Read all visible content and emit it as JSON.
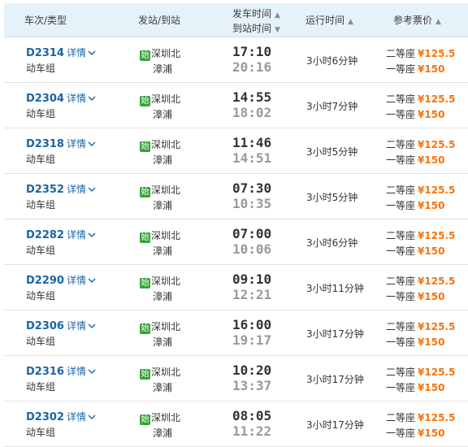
{
  "header": {
    "train_type": "车次/类型",
    "station": "发站/到站",
    "depart_time": "发车时间",
    "arrive_time": "到站时间",
    "duration": "运行时间",
    "price": "参考票价"
  },
  "labels": {
    "detail": "详情",
    "start_badge": "始",
    "second_class": "二等座",
    "first_class": "一等座"
  },
  "rows": [
    {
      "train": "D2314",
      "type": "动车组",
      "from": "深圳北",
      "to": "漳浦",
      "dep": "17:10",
      "arr": "20:16",
      "duration": "3小时6分钟",
      "p2": "¥125.5",
      "p1": "¥150"
    },
    {
      "train": "D2304",
      "type": "动车组",
      "from": "深圳北",
      "to": "漳浦",
      "dep": "14:55",
      "arr": "18:02",
      "duration": "3小时7分钟",
      "p2": "¥125.5",
      "p1": "¥150"
    },
    {
      "train": "D2318",
      "type": "动车组",
      "from": "深圳北",
      "to": "漳浦",
      "dep": "11:46",
      "arr": "14:51",
      "duration": "3小时5分钟",
      "p2": "¥125.5",
      "p1": "¥150"
    },
    {
      "train": "D2352",
      "type": "动车组",
      "from": "深圳北",
      "to": "漳浦",
      "dep": "07:30",
      "arr": "10:35",
      "duration": "3小时5分钟",
      "p2": "¥125.5",
      "p1": "¥150"
    },
    {
      "train": "D2282",
      "type": "动车组",
      "from": "深圳北",
      "to": "漳浦",
      "dep": "07:00",
      "arr": "10:06",
      "duration": "3小时6分钟",
      "p2": "¥125.5",
      "p1": "¥150"
    },
    {
      "train": "D2290",
      "type": "动车组",
      "from": "深圳北",
      "to": "漳浦",
      "dep": "09:10",
      "arr": "12:21",
      "duration": "3小时11分钟",
      "p2": "¥125.5",
      "p1": "¥150"
    },
    {
      "train": "D2306",
      "type": "动车组",
      "from": "深圳北",
      "to": "漳浦",
      "dep": "16:00",
      "arr": "19:17",
      "duration": "3小时17分钟",
      "p2": "¥125.5",
      "p1": "¥150"
    },
    {
      "train": "D2316",
      "type": "动车组",
      "from": "深圳北",
      "to": "漳浦",
      "dep": "10:20",
      "arr": "13:37",
      "duration": "3小时17分钟",
      "p2": "¥125.5",
      "p1": "¥150"
    },
    {
      "train": "D2302",
      "type": "动车组",
      "from": "深圳北",
      "to": "漳浦",
      "dep": "08:05",
      "arr": "11:22",
      "duration": "3小时17分钟",
      "p2": "¥125.5",
      "p1": "¥150"
    }
  ],
  "colors": {
    "header_bg": "#e6f2fa",
    "link": "#1a64a6",
    "price": "#f7740f",
    "start_badge": "#35a33a",
    "arrival_time": "#999999"
  },
  "icons": {
    "sort": "sort-up-down-icon",
    "detail": "chevron-down-icon"
  }
}
